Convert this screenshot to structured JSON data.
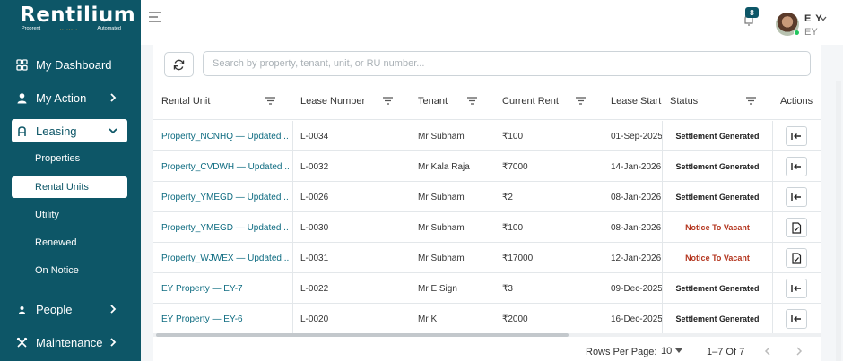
{
  "brand": {
    "name": "Rentilium",
    "tag_left": "Proprent",
    "tag_dots": "........",
    "tag_right": "Automated"
  },
  "sidebar": {
    "items": [
      {
        "label": "My Dashboard",
        "icon": "grid-icon"
      },
      {
        "label": "My Action",
        "icon": "user-icon"
      },
      {
        "label": "Leasing",
        "icon": "leasing-icon"
      },
      {
        "label": "People",
        "icon": "people-icon"
      },
      {
        "label": "Maintenance",
        "icon": "tools-icon"
      }
    ],
    "leasing_sub": [
      "Properties",
      "Rental Units",
      "Utility",
      "Renewed",
      "On Notice"
    ]
  },
  "header": {
    "notifications": "8",
    "user_initials": "E Y",
    "user_sub": "EY"
  },
  "search": {
    "placeholder": "Search by property, tenant, unit, or RU number..."
  },
  "table": {
    "headers": [
      "Rental Unit",
      "Lease Number",
      "Tenant",
      "Current Rent",
      "Lease Start",
      "Status",
      "Actions"
    ],
    "rows": [
      {
        "unit": "Property_NCNHQ — Updated ...",
        "lease": "L-0034",
        "tenant": "Mr Subham",
        "rent": "₹100",
        "start": "01-Sep-2025",
        "status": "Settlement Generated",
        "kind": "gen"
      },
      {
        "unit": "Property_CVDWH — Updated ...",
        "lease": "L-0032",
        "tenant": "Mr Kala Raja",
        "rent": "₹7000",
        "start": "14-Jan-2026",
        "status": "Settlement Generated",
        "kind": "gen"
      },
      {
        "unit": "Property_YMEGD — Updated ...",
        "lease": "L-0026",
        "tenant": "Mr Subham",
        "rent": "₹2",
        "start": "08-Jan-2026",
        "status": "Settlement Generated",
        "kind": "gen"
      },
      {
        "unit": "Property_YMEGD — Updated ...",
        "lease": "L-0030",
        "tenant": "Mr Subham",
        "rent": "₹100",
        "start": "08-Jan-2026",
        "status": "Notice To Vacant",
        "kind": "notice"
      },
      {
        "unit": "Property_WJWEX — Updated ...",
        "lease": "L-0031",
        "tenant": "Mr Subham",
        "rent": "₹17000",
        "start": "12-Jan-2026",
        "status": "Notice To Vacant",
        "kind": "notice"
      },
      {
        "unit": "EY Property — EY-7",
        "lease": "L-0022",
        "tenant": "Mr E Sign",
        "rent": "₹3",
        "start": "09-Dec-2025",
        "status": "Settlement Generated",
        "kind": "gen"
      },
      {
        "unit": "EY Property — EY-6",
        "lease": "L-0020",
        "tenant": "Mr K",
        "rent": "₹2000",
        "start": "16-Dec-2025",
        "status": "Settlement Generated",
        "kind": "gen"
      }
    ]
  },
  "pagination": {
    "label": "Rows Per Page:",
    "rows_per_page": "10",
    "range": "1–7 Of 7"
  }
}
